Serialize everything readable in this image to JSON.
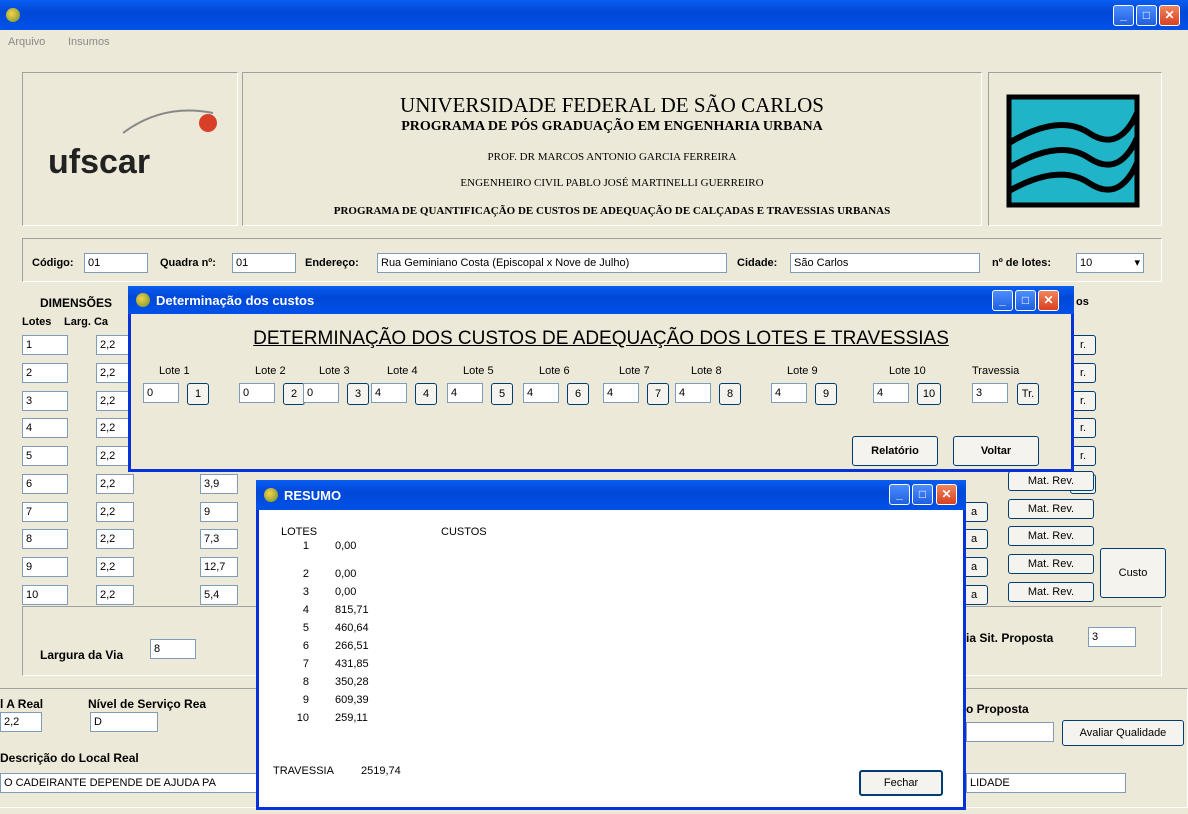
{
  "menu": {
    "arquivo": "Arquivo",
    "insumos": "Insumos"
  },
  "header": {
    "univ": "UNIVERSIDADE FEDERAL DE SÃO  CARLOS",
    "program": "PROGRAMA DE PÓS GRADUAÇÃO EM ENGENHARIA URBANA",
    "prof": "PROF. DR MARCOS ANTONIO GARCIA FERREIRA",
    "eng": "ENGENHEIRO CIVIL PABLO JOSÉ MARTINELLI GUERREIRO",
    "title": "PROGRAMA DE QUANTIFICAÇÃO DE CUSTOS DE ADEQUAÇÃO DE CALÇADAS E TRAVESSIAS URBANAS",
    "logo": "ufscar"
  },
  "form": {
    "codigo_label": "Código:",
    "codigo": "01",
    "quadra_label": "Quadra nº:",
    "quadra": "01",
    "endereco_label": "Endereço:",
    "endereco": "Rua Geminiano Costa (Episcopal x Nove de Julho)",
    "cidade_label": "Cidade:",
    "cidade": "São Carlos",
    "lotes_label": "nº de lotes:",
    "lotes": "10"
  },
  "dimensoes": {
    "title": "DIMENSÕES",
    "col_lotes": "Lotes",
    "col_larg": "Larg. Ca",
    "right_title": "os",
    "lotes": [
      "1",
      "2",
      "3",
      "4",
      "5",
      "6",
      "7",
      "8",
      "9",
      "10"
    ],
    "larg": [
      "2,2",
      "2,2",
      "2,2",
      "2,2",
      "2,2",
      "2,2",
      "2,2",
      "2,2",
      "2,2",
      "2,2"
    ],
    "third": [
      "3,9",
      "9",
      "7,3",
      "12,7",
      "5,4"
    ],
    "col_btn_a": "a",
    "matrev_partial": "r.",
    "matrev": "Mat. Rev.",
    "custo": "Custo"
  },
  "via": {
    "label": "Largura da Via",
    "value": "8",
    "prop_label": "ia Sit. Proposta",
    "prop_value": "3"
  },
  "bottom": {
    "real_label": "l A Real",
    "real_value": "2,2",
    "nivel_label": "Nível de Serviço Rea",
    "nivel_value": "D",
    "proposta_label": "o Proposta",
    "avaliar": "Avaliar Qualidade",
    "desc_label": "Descrição do Local Real",
    "desc_value": "O CADEIRANTE DEPENDE DE AJUDA PA",
    "desc_right": "LIDADE"
  },
  "custos_window": {
    "title": "Determinação dos custos",
    "heading": "DETERMINAÇÃO DOS CUSTOS DE ADEQUAÇÃO DOS LOTES E TRAVESSIAS",
    "lotes": [
      {
        "label": "Lote 1",
        "value": "0",
        "btn": "1"
      },
      {
        "label": "Lote 2",
        "value": "0",
        "btn": "2"
      },
      {
        "label": "Lote 3",
        "value": "0",
        "btn": "3"
      },
      {
        "label": "Lote 4",
        "value": "4",
        "btn": "4"
      },
      {
        "label": "Lote 5",
        "value": "4",
        "btn": "5"
      },
      {
        "label": "Lote 6",
        "value": "4",
        "btn": "6"
      },
      {
        "label": "Lote 7",
        "value": "4",
        "btn": "7"
      },
      {
        "label": "Lote 8",
        "value": "4",
        "btn": "8"
      },
      {
        "label": "Lote 9",
        "value": "4",
        "btn": "9"
      },
      {
        "label": "Lote 10",
        "value": "4",
        "btn": "10"
      }
    ],
    "travessia_label": "Travessia",
    "travessia_value": "3",
    "travessia_btn": "Tr.",
    "relatorio": "Relatório",
    "voltar": "Voltar"
  },
  "resumo": {
    "title": "RESUMO",
    "col_lotes": "LOTES",
    "col_custos": "CUSTOS",
    "rows": [
      {
        "lote": "1",
        "custo": "0,00"
      },
      {
        "lote": "2",
        "custo": "0,00"
      },
      {
        "lote": "3",
        "custo": "0,00"
      },
      {
        "lote": "4",
        "custo": "815,71"
      },
      {
        "lote": "5",
        "custo": "460,64"
      },
      {
        "lote": "6",
        "custo": "266,51"
      },
      {
        "lote": "7",
        "custo": "431,85"
      },
      {
        "lote": "8",
        "custo": "350,28"
      },
      {
        "lote": "9",
        "custo": "609,39"
      },
      {
        "lote": "10",
        "custo": "259,11"
      }
    ],
    "travessia_label": "TRAVESSIA",
    "travessia_value": "2519,74",
    "fechar": "Fechar"
  },
  "colors": {
    "titlebar": "#0054e3",
    "face": "#ece9d8",
    "teal": "#1fb4c8"
  }
}
